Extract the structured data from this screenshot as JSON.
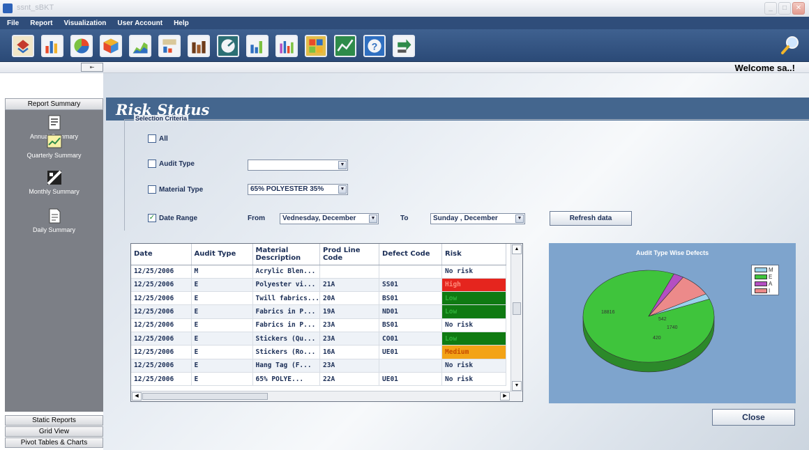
{
  "window": {
    "title": "ssnt_sBKT"
  },
  "menu": [
    "File",
    "Report",
    "Visualization",
    "User Account",
    "Help"
  ],
  "toolbar_icons": [
    "report-icon",
    "bar-chart-icon",
    "pie-icon",
    "cube-icon",
    "area-chart-icon",
    "data-chart-icon",
    "column-chart-icon",
    "gauge-icon",
    "bar-chart-2-icon",
    "stacked-chart-icon",
    "map-chart-icon",
    "line-chart-icon",
    "help-icon",
    "export-icon"
  ],
  "welcome": "Welcome  sa..!",
  "sidebar": {
    "top_label": "Report Summary",
    "items": [
      {
        "label": "Annual Summary",
        "icon": "annual-summary-icon"
      },
      {
        "label": "Quarterly Summary",
        "icon": "quarterly-summary-icon"
      },
      {
        "label": "Monthly Summary",
        "icon": "monthly-summary-icon"
      },
      {
        "label": "Daily Summary",
        "icon": "daily-summary-icon"
      }
    ],
    "bottom": [
      "Static Reports",
      "Grid View",
      "Pivot Tables & Charts"
    ]
  },
  "page": {
    "title": "Risk Status",
    "criteria_legend": "Selection Criteria",
    "all_label": "All",
    "audit_type_label": "Audit Type",
    "audit_type_value": "",
    "material_type_label": "Material Type",
    "material_type_value": "65% POLYESTER 35%",
    "date_range_label": "Date Range",
    "from_label": "From",
    "from_value": "Vednesday, December",
    "to_label": "To",
    "to_value": "Sunday    , December",
    "refresh_label": "Refresh data",
    "close_label": "Close",
    "checks": {
      "all": false,
      "audit_type": false,
      "material_type": false,
      "date_range": true
    }
  },
  "grid": {
    "columns": [
      "Date",
      "Audit Type",
      "Material Description",
      "Prod Line Code",
      "Defect Code",
      "Risk"
    ],
    "rows": [
      [
        "12/25/2006",
        "M",
        "Acrylic Blen...",
        "",
        "",
        "No risk"
      ],
      [
        "12/25/2006",
        "E",
        "Polyester vi...",
        "21A",
        "SS01",
        "High"
      ],
      [
        "12/25/2006",
        "E",
        "Twill fabrics...",
        "20A",
        "BS01",
        "Low"
      ],
      [
        "12/25/2006",
        "E",
        "Fabrics in P...",
        "19A",
        "ND01",
        "Low"
      ],
      [
        "12/25/2006",
        "E",
        "Fabrics in P...",
        "23A",
        "BS01",
        "No risk"
      ],
      [
        "12/25/2006",
        "E",
        "Stickers (Qu...",
        "23A",
        "CO01",
        "Low"
      ],
      [
        "12/25/2006",
        "E",
        "Stickers (Ro...",
        "16A",
        "UE01",
        "Medium"
      ],
      [
        "12/25/2006",
        "E",
        "Hang Tag (F...",
        "23A",
        "",
        "No risk"
      ],
      [
        "12/25/2006",
        "E",
        "65% POLYE...",
        "22A",
        "UE01",
        "No risk"
      ]
    ]
  },
  "risk_colors": {
    "High": "#e5251e",
    "Low": "#0f7a12",
    "Medium": "#f3a316",
    "No risk": ""
  },
  "chart_data": {
    "type": "pie",
    "title": "Audit Type Wise Defects",
    "categories": [
      "M",
      "E",
      "A",
      "I"
    ],
    "colors": [
      "#9ad2ec",
      "#3fc43c",
      "#b44fc2",
      "#ec8a8a"
    ],
    "legend_position": "top-right",
    "values": [
      420,
      18816,
      542,
      1740
    ],
    "data_labels": [
      "420",
      "18816",
      "542",
      "1740"
    ]
  }
}
